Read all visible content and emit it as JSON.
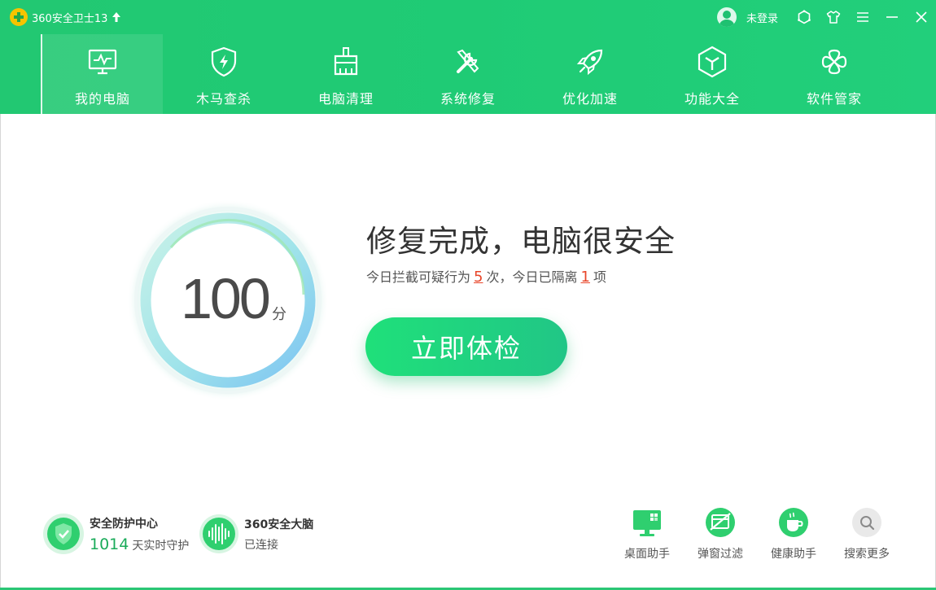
{
  "app": {
    "title": "360安全卫士13",
    "login_label": "未登录"
  },
  "colors": {
    "header_green": "#22c872",
    "accent_green": "#1fe07a",
    "highlight_red": "#e8462a"
  },
  "nav": {
    "items": [
      {
        "label": "我的电脑",
        "icon": "monitor-icon",
        "active": true
      },
      {
        "label": "木马查杀",
        "icon": "shield-bolt-icon"
      },
      {
        "label": "电脑清理",
        "icon": "broom-icon"
      },
      {
        "label": "系统修复",
        "icon": "tools-icon"
      },
      {
        "label": "优化加速",
        "icon": "rocket-icon"
      },
      {
        "label": "功能大全",
        "icon": "cube-icon"
      },
      {
        "label": "软件管家",
        "icon": "flower-icon"
      }
    ]
  },
  "main": {
    "score": "100",
    "score_unit": "分",
    "headline": "修复完成，电脑很安全",
    "sub_prefix": "今日拦截可疑行为",
    "blocked_count": "5",
    "sub_middle": "次，今日已隔离",
    "quarantined_count": "1",
    "sub_suffix": "项",
    "cta_label": "立即体检"
  },
  "status": {
    "protection_title": "安全防护中心",
    "protection_days": "1014",
    "protection_days_label": "天实时守护",
    "brain_title": "360安全大脑",
    "brain_status": "已连接"
  },
  "tools": [
    {
      "label": "桌面助手",
      "icon": "desktop-helper-icon"
    },
    {
      "label": "弹窗过滤",
      "icon": "popup-filter-icon"
    },
    {
      "label": "健康助手",
      "icon": "health-cup-icon"
    },
    {
      "label": "搜索更多",
      "icon": "search-icon"
    }
  ]
}
